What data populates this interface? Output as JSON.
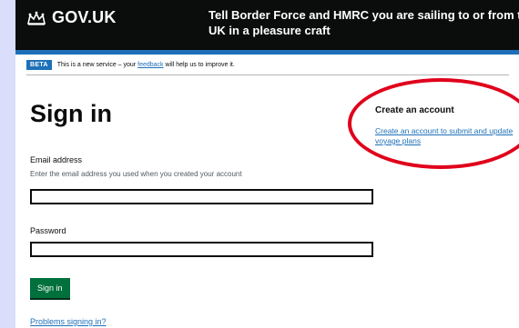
{
  "header": {
    "logo_text": "GOV.UK",
    "service_name": "Tell Border Force and HMRC you are sailing to or from the UK in a pleasure craft"
  },
  "phase_banner": {
    "tag": "BETA",
    "text_before": "This is a new service – your",
    "link": "feedback",
    "text_after": "will help us to improve it."
  },
  "main": {
    "title": "Sign in",
    "email_label": "Email address",
    "email_hint": "Enter the email address you used when you created your account",
    "email_value": "",
    "password_label": "Password",
    "password_value": "",
    "signin_button": "Sign in",
    "problems_link": "Problems signing in?"
  },
  "aside": {
    "title": "Create an account",
    "link": "Create an account to submit and update voyage plans"
  },
  "colors": {
    "header_bg": "#0b0c0c",
    "link_blue": "#1d70b8",
    "button_green": "#00703c",
    "annotation_red": "#e0001b"
  }
}
